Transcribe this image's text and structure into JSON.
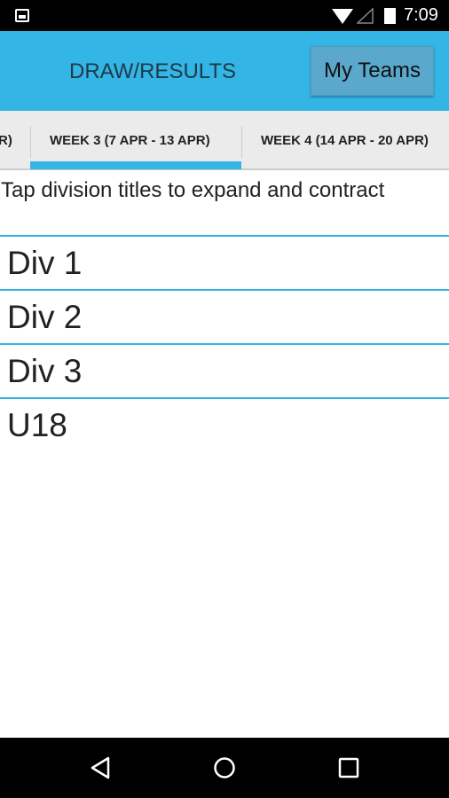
{
  "status_bar": {
    "time": "7:09",
    "icons": [
      "image-icon",
      "wifi-icon",
      "signal-icon",
      "battery-icon"
    ]
  },
  "app_bar": {
    "title": "DRAW/RESULTS",
    "my_teams_label": "My Teams",
    "color": "#33b5e5"
  },
  "tabs": [
    {
      "label": "R)"
    },
    {
      "label": "WEEK 3 (7 APR - 13 APR)",
      "selected": true
    },
    {
      "label": "WEEK 4 (14 APR - 20 APR)"
    }
  ],
  "hint": "Tap division titles to expand and contract",
  "divisions": [
    {
      "label": "Div 1"
    },
    {
      "label": "Div 2"
    },
    {
      "label": "Div 3"
    },
    {
      "label": "U18"
    }
  ],
  "nav_bar": {
    "icons": [
      "back-icon",
      "home-icon",
      "recents-icon"
    ]
  }
}
